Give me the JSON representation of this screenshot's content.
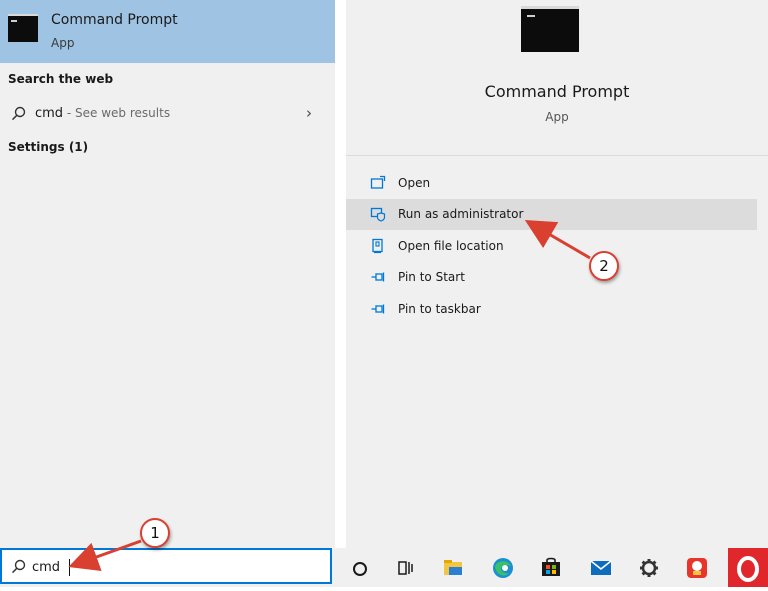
{
  "best_match": {
    "title": "Command Prompt",
    "subtitle": "App"
  },
  "sections": {
    "web": "Search the web",
    "settings": "Settings (1)"
  },
  "web_result": {
    "query": "cmd",
    "suffix": " - See web results"
  },
  "detail": {
    "title": "Command Prompt",
    "subtitle": "App",
    "actions": [
      {
        "label": "Open",
        "icon": "open-window-icon"
      },
      {
        "label": "Run as administrator",
        "icon": "shield-admin-icon"
      },
      {
        "label": "Open file location",
        "icon": "file-location-icon"
      },
      {
        "label": "Pin to Start",
        "icon": "pin-icon"
      },
      {
        "label": "Pin to taskbar",
        "icon": "pin-icon"
      }
    ]
  },
  "search": {
    "value": "cmd"
  },
  "callouts": [
    "1",
    "2"
  ],
  "taskbar_icons": [
    "cortana-circle-icon",
    "task-view-icon",
    "file-explorer-icon",
    "edge-icon",
    "store-icon",
    "mail-icon",
    "settings-gear-icon",
    "app-icon",
    "opera-icon"
  ],
  "colors": {
    "accent": "#0078d7",
    "selection": "#9fc3e3",
    "annotation": "#d94030"
  }
}
